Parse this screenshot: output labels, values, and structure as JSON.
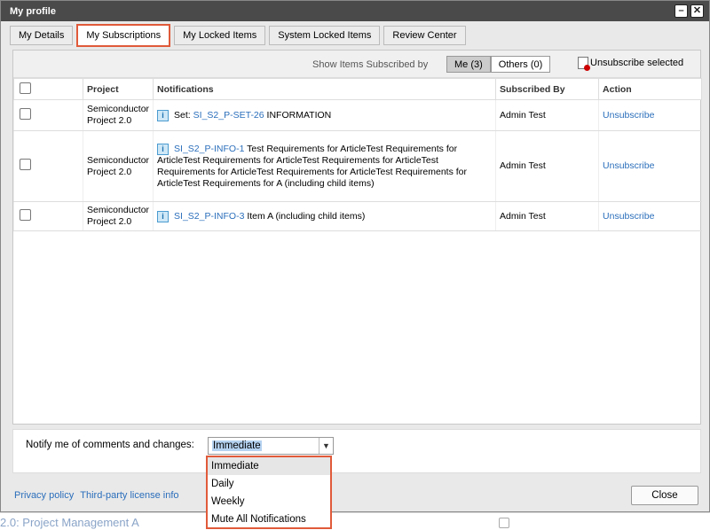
{
  "window": {
    "title": "My profile"
  },
  "tabs": [
    {
      "label": "My Details"
    },
    {
      "label": "My Subscriptions",
      "active": true
    },
    {
      "label": "My Locked Items"
    },
    {
      "label": "System Locked Items"
    },
    {
      "label": "Review Center"
    }
  ],
  "filter": {
    "label": "Show Items Subscribed by",
    "me": "Me (3)",
    "others": "Others (0)",
    "unsubscribe_selected": "Unsubscribe selected"
  },
  "table": {
    "headers": [
      "Project",
      "Notifications",
      "Subscribed By",
      "Action"
    ],
    "rows": [
      {
        "project": "Semiconductor Project 2.0",
        "prefix": "Set: ",
        "link": "SI_S2_P-SET-26",
        "text": " INFORMATION",
        "by": "Admin Test",
        "action": "Unsubscribe"
      },
      {
        "project": "Semiconductor Project 2.0",
        "prefix": "",
        "link": "SI_S2_P-INFO-1",
        "text": " Test Requirements for ArticleTest Requirements for ArticleTest Requirements for ArticleTest Requirements for ArticleTest Requirements for ArticleTest Requirements for ArticleTest Requirements for ArticleTest Requirements for A (including child items)",
        "by": "Admin Test",
        "action": "Unsubscribe"
      },
      {
        "project": "Semiconductor Project 2.0",
        "prefix": "",
        "link": "SI_S2_P-INFO-3",
        "text": " Item A (including child items)",
        "by": "Admin Test",
        "action": "Unsubscribe"
      }
    ]
  },
  "notify": {
    "label": "Notify me of comments and changes:",
    "selected": "Immediate",
    "options": [
      "Immediate",
      "Daily",
      "Weekly",
      "Mute All Notifications"
    ]
  },
  "footer": {
    "privacy": "Privacy policy",
    "license": "Third-party license info",
    "close": "Close"
  },
  "background": {
    "link_text": "2.0: Project Management A"
  },
  "colors": {
    "highlight_border": "#e05a3a",
    "link": "#2a6ebb",
    "titlebar": "#4a4a4a"
  }
}
